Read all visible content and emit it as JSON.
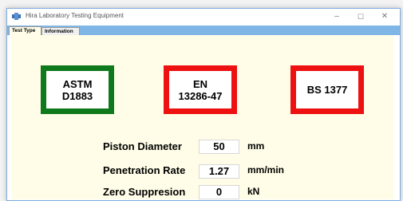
{
  "window": {
    "title": "Hira Laboratory Testing Equipment",
    "controls": {
      "minimize": "–",
      "maximize": "☐",
      "close": "✕"
    },
    "icon": "app-icon"
  },
  "tabs": [
    {
      "label": "Test Type",
      "active": true
    },
    {
      "label": "Information",
      "active": false
    }
  ],
  "standards": [
    {
      "line1": "ASTM",
      "line2": "D1883",
      "border_color": "#0f7a1c",
      "selected": true
    },
    {
      "line1": "EN",
      "line2": "13286-47",
      "border_color": "#ee1111",
      "selected": false
    },
    {
      "line1": "BS  1377",
      "line2": "",
      "border_color": "#ee1111",
      "selected": false
    }
  ],
  "parameters": [
    {
      "label": "Piston Diameter",
      "value": "50",
      "unit": "mm"
    },
    {
      "label": "Penetration Rate",
      "value": "1.27",
      "unit": "mm/min"
    },
    {
      "label": "Zero Suppresion",
      "value": "0",
      "unit": "kN"
    }
  ],
  "colors": {
    "panel_bg": "#fffde7",
    "tab_strip": "#7fb6e6",
    "selected": "#0f7a1c",
    "unselected": "#ee1111"
  }
}
